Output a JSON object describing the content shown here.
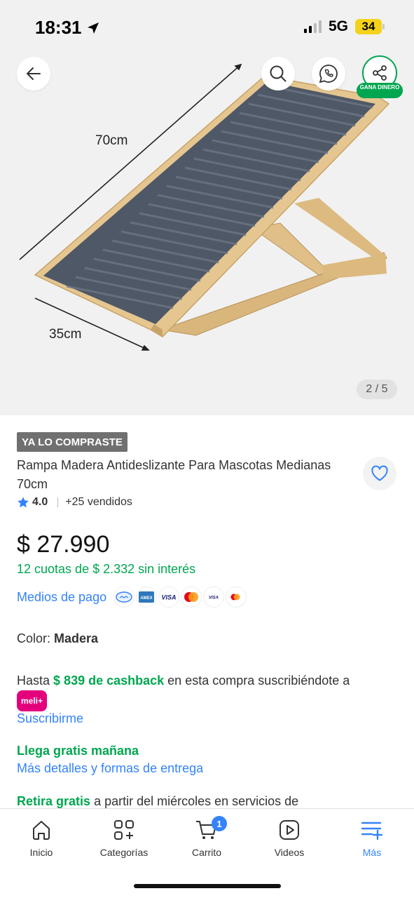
{
  "status_bar": {
    "time": "18:31",
    "network": "5G",
    "battery": "34"
  },
  "gallery": {
    "image_counter": "2 / 5",
    "dimension_length": "70cm",
    "dimension_width": "35cm",
    "share_badge": "GANA DINERO",
    "icons": [
      "arrow-left-icon",
      "search-icon",
      "whatsapp-icon",
      "share-icon"
    ]
  },
  "product": {
    "purchased_badge": "YA LO COMPRASTE",
    "title": "Rampa  Madera Antideslizante Para Mascotas Medianas 70cm",
    "rating": "4.0",
    "sold": "+25 vendidos",
    "price": "$ 27.990",
    "installments": "12 cuotas de $ 2.332 sin interés",
    "payment_link": "Medios de pago",
    "payment_icons": [
      "mercadopago-icon",
      "amex-icon",
      "visa-icon",
      "mastercard-icon",
      "visa-debit-icon",
      "mastercard-debit-icon"
    ]
  },
  "color": {
    "label": "Color:",
    "value": "Madera"
  },
  "cashback": {
    "prefix": "Hasta",
    "amount": "$ 839 de cashback",
    "suffix": "en esta compra suscribiéndote a",
    "meli_badge": "meli+",
    "subscribe_link": "Suscribirme"
  },
  "delivery": {
    "free_text": "Llega gratis mañana",
    "details_link": "Más detalles y formas de entrega",
    "pickup_prefix": "Retira gratis",
    "pickup_text": "a partir del miércoles en servicios de"
  },
  "bottom_nav": {
    "items": [
      {
        "label": "Inicio",
        "icon": "home-icon"
      },
      {
        "label": "Categorías",
        "icon": "categories-icon"
      },
      {
        "label": "Carrito",
        "icon": "cart-icon",
        "badge": "1"
      },
      {
        "label": "Videos",
        "icon": "video-icon"
      },
      {
        "label": "Más",
        "icon": "more-icon"
      }
    ]
  },
  "colors": {
    "green": "#00a650",
    "blue": "#3483fa",
    "meli_pink": "#e4007c",
    "badge_gray": "#707070"
  }
}
